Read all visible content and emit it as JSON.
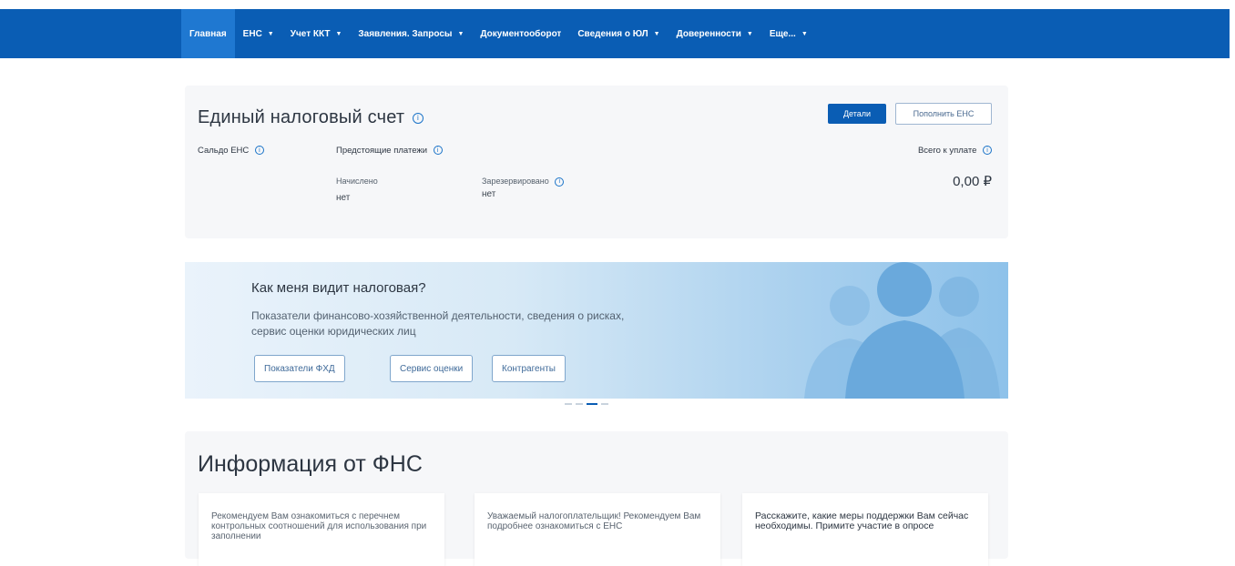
{
  "nav": {
    "items": [
      {
        "label": "Главная",
        "active": true,
        "has_caret": false
      },
      {
        "label": "ЕНС",
        "active": false,
        "has_caret": true
      },
      {
        "label": "Учет ККТ",
        "active": false,
        "has_caret": true
      },
      {
        "label": "Заявления. Запросы",
        "active": false,
        "has_caret": true
      },
      {
        "label": "Документооборот",
        "active": false,
        "has_caret": false
      },
      {
        "label": "Сведения о ЮЛ",
        "active": false,
        "has_caret": true
      },
      {
        "label": "Доверенности",
        "active": false,
        "has_caret": true
      },
      {
        "label": "Еще...",
        "active": false,
        "has_caret": true
      }
    ],
    "caret_glyph": "▼"
  },
  "ens": {
    "title": "Единый налоговый счет",
    "details_button": "Детали",
    "topup_button": "Пополнить ЕНС",
    "saldo_label": "Сальдо ЕНС",
    "upcoming_label": "Предстоящие платежи",
    "accrued_label": "Начислено",
    "accrued_value": "нет",
    "reserved_label": "Зарезервировано",
    "reserved_value": "нет",
    "total_label": "Всего к уплате",
    "total_amount": "0,00 ₽"
  },
  "banner": {
    "title": "Как меня видит налоговая?",
    "text": "Показатели финансово-хозяйственной деятельности, сведения о рисках, сервис оценки юридических лиц",
    "buttons": [
      "Показатели ФХД",
      "Сервис оценки",
      "Контрагенты"
    ],
    "slides_count": 4,
    "active_slide": 3
  },
  "info": {
    "title": "Информация от ФНС",
    "cards": [
      "Рекомендуем Вам ознакомиться с перечнем контрольных соотношений для использования при заполнении",
      "Уважаемый налогоплательщик! Рекомендуем Вам подробнее ознакомиться с ЕНС",
      "Расскажите, какие меры поддержки Вам сейчас необходимы. Примите участие в опросе"
    ]
  },
  "colors": {
    "header_bg": "#0a5db4",
    "active_tab": "#1f78d1",
    "accent": "#1a73c8"
  },
  "icons": {
    "info": "info-circle-icon",
    "caret": "chevron-down-icon",
    "people": "people-silhouette-icon"
  }
}
